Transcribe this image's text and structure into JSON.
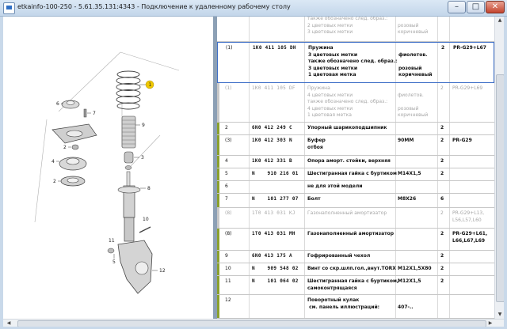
{
  "window": {
    "title": "etkainfo-100-250 - 5.61.35.131:4343 - Подключение к удаленному рабочему столу",
    "minimize": "–",
    "maximize": "□",
    "close": "✕"
  },
  "diagram": {
    "callouts": [
      "1",
      "6",
      "7",
      "9",
      "2",
      "3",
      "4",
      "2",
      "8",
      "10",
      "11",
      "12",
      "5"
    ],
    "highlight_color": "#f0c800"
  },
  "colors": {
    "bar_green": "#8aa02d",
    "bar_grey": "#c8c8c8",
    "selected_border": "#3d6ec7"
  },
  "rows": [
    {
      "pos": "",
      "partno": "",
      "desc": "также обозначено след. образ.:\n2 цветовых метки\n3 цветовых метки",
      "note": "\nрозовый\nкоричневый",
      "qty": "",
      "mod": "",
      "style": "grey",
      "bar": "none"
    },
    {
      "pos": "(1)",
      "partno": "1K0 411 105 DH",
      "desc": "Пружина\n3 цветовых метки\nтакже обозначено след. образ.:\n3 цветовых метки\n1 цветовая метка",
      "note": "\nфиолетов.\n\nрозовый\nкоричневый",
      "qty": "2",
      "mod": "PR-G29+L67",
      "style": "selected",
      "bar": "none"
    },
    {
      "pos": "(1)",
      "partno": "1K0 411 105 DF",
      "desc": "Пружина\n4 цветовых метки\nтакже обозначено след. образ.:\n4 цветовых метки\n1 цветовая метка",
      "note": "\nфиолетов.\n\nрозовый\nкоричневый",
      "qty": "2",
      "mod": "PR-G29+L69",
      "style": "grey",
      "bar": "grey"
    },
    {
      "pos": "2",
      "partno": "6N0 412 249 C",
      "desc": "Упорный шарикоподшипник",
      "note": "",
      "qty": "2",
      "mod": "",
      "style": "normal",
      "bar": "green"
    },
    {
      "pos": "(3)",
      "partno": "1K0 412 303 N",
      "desc": "Буфер\nотбоя",
      "note": "90MM",
      "qty": "2",
      "mod": "PR-G29",
      "style": "normal",
      "bar": "green"
    },
    {
      "pos": "4",
      "partno": "1K0 412 331 B",
      "desc": "Опора аморт. стойки, верхняя",
      "note": "",
      "qty": "2",
      "mod": "",
      "style": "normal",
      "bar": "green"
    },
    {
      "pos": "5",
      "partno": "N    910 216 01",
      "desc": "Шестигранная гайка с буртиком",
      "note": "M14X1,5",
      "qty": "2",
      "mod": "",
      "style": "normal",
      "bar": "green"
    },
    {
      "pos": "6",
      "partno": "",
      "desc": "не для этой модели",
      "note": "",
      "qty": "",
      "mod": "",
      "style": "normal",
      "bar": "green"
    },
    {
      "pos": "7",
      "partno": "N    101 277 07",
      "desc": "Болт",
      "note": "M8X26",
      "qty": "6",
      "mod": "",
      "style": "normal",
      "bar": "green"
    },
    {
      "pos": "(8)",
      "partno": "1T0 413 031 KJ",
      "desc": "Газонаполненный амортизатор",
      "note": "",
      "qty": "2",
      "mod": "PR-G29+L13,\nL56,L57,L60",
      "style": "grey",
      "bar": "grey"
    },
    {
      "pos": "(8)",
      "partno": "1T0 413 031 MH",
      "desc": "Газонаполненный амортизатор",
      "note": "",
      "qty": "2",
      "mod": "PR-G29+L61,\nL66,L67,L69",
      "style": "normal",
      "bar": "green"
    },
    {
      "pos": "9",
      "partno": "6N0 413 175 A",
      "desc": "Гофрированный чехол",
      "note": "",
      "qty": "2",
      "mod": "",
      "style": "normal",
      "bar": "green"
    },
    {
      "pos": "10",
      "partno": "N    909 548 02",
      "desc": "Винт со скр.шлп.гол.,внут.TORX",
      "note": "M12X1,5X80",
      "qty": "2",
      "mod": "",
      "style": "normal",
      "bar": "green"
    },
    {
      "pos": "11",
      "partno": "N    101 064 02",
      "desc": "Шестигранная гайка с буртиком,\nсамоконтрящаяся",
      "note": "M12X1,5",
      "qty": "2",
      "mod": "",
      "style": "normal",
      "bar": "green"
    },
    {
      "pos": "12",
      "partno": "",
      "desc": "Поворотный кулак\n см. панель иллюстраций:",
      "note": "\n407-..",
      "qty": "",
      "mod": "",
      "style": "normal",
      "bar": "green"
    }
  ]
}
